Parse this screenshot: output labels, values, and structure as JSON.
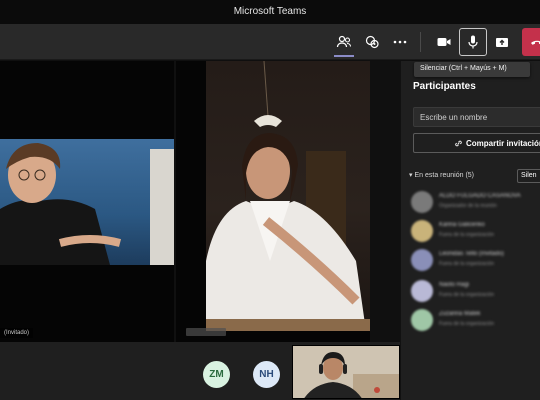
{
  "window": {
    "title": "Microsoft Teams"
  },
  "toolbar": {
    "icons": [
      "people-icon",
      "chat-icon",
      "more-icon",
      "camera-icon",
      "microphone-icon",
      "share-tray-icon",
      "hang-up-icon"
    ],
    "tooltip": "Silenciar (Ctrl + Mayús + M)",
    "hangup_color": "#c4314b",
    "active_color": "#8b8cc7"
  },
  "stage": {
    "left_tile": {
      "name_tag": "(Invitado)"
    },
    "avatars": [
      {
        "initials": "ZM"
      },
      {
        "initials": "NH"
      }
    ]
  },
  "participants_panel": {
    "title": "Participantes",
    "search_placeholder": "Escribe un nombre",
    "invite_label": "Compartir invitación",
    "section_label": "En esta reunión (5)",
    "mute_all_label": "Silen",
    "people": [
      {
        "name": "ALDO FULGADO CASANOVA",
        "status": "Organizador de la reunión",
        "avatar_color": "#7a7a7a"
      },
      {
        "name": "Karina Galicenko",
        "status": "Fuera de la organización",
        "avatar_color": "#c9b37a"
      },
      {
        "name": "Leonidas Tello (Invitado)",
        "status": "Fuera de la organización",
        "avatar_color": "#8a8fb8"
      },
      {
        "name": "Naoto Hagi",
        "status": "Fuera de la organización",
        "avatar_color": "#b9b9d6"
      },
      {
        "name": "Zuzanna Matek",
        "status": "Fuera de la organización",
        "avatar_color": "#9fc7a6"
      }
    ]
  }
}
